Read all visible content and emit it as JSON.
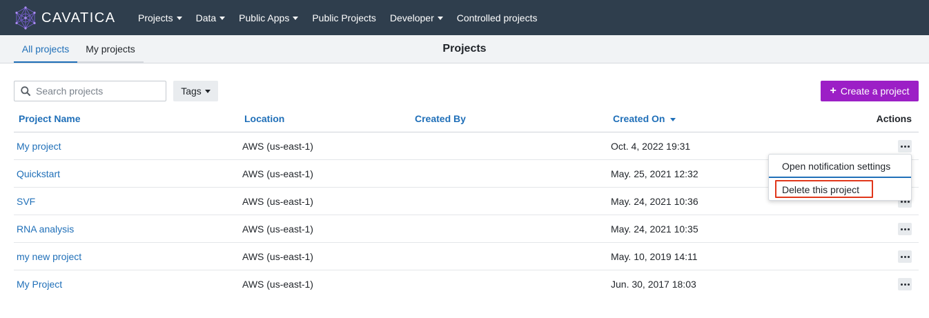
{
  "app": {
    "logo_text": "CAVATICA"
  },
  "nav": {
    "items": [
      {
        "label": "Projects",
        "dropdown": true
      },
      {
        "label": "Data",
        "dropdown": true
      },
      {
        "label": "Public Apps",
        "dropdown": true
      },
      {
        "label": "Public Projects",
        "dropdown": false
      },
      {
        "label": "Developer",
        "dropdown": true
      },
      {
        "label": "Controlled projects",
        "dropdown": false
      }
    ]
  },
  "subheader": {
    "tabs": [
      {
        "label": "All projects",
        "active": true
      },
      {
        "label": "My projects",
        "active": false
      }
    ],
    "title": "Projects"
  },
  "toolbar": {
    "search_placeholder": "Search projects",
    "search_value": "",
    "tags_label": "Tags",
    "create_label": "Create a project"
  },
  "table": {
    "columns": [
      "Project Name",
      "Location",
      "Created By",
      "Created On",
      "Actions"
    ],
    "sorted_column": "Created On",
    "sort_direction": "descending",
    "rows": [
      {
        "name": "My project",
        "location": "AWS (us-east-1)",
        "created_by": "",
        "created_on": "Oct. 4, 2022 19:31"
      },
      {
        "name": "Quickstart",
        "location": "AWS (us-east-1)",
        "created_by": "",
        "created_on": "May. 25, 2021 12:32"
      },
      {
        "name": "SVF",
        "location": "AWS (us-east-1)",
        "created_by": "",
        "created_on": "May. 24, 2021 10:36"
      },
      {
        "name": "RNA analysis",
        "location": "AWS (us-east-1)",
        "created_by": "",
        "created_on": "May. 24, 2021 10:35"
      },
      {
        "name": "my new project",
        "location": "AWS (us-east-1)",
        "created_by": "",
        "created_on": "May. 10, 2019 14:11"
      },
      {
        "name": "My Project",
        "location": "AWS (us-east-1)",
        "created_by": "",
        "created_on": "Jun. 30, 2017 18:03"
      }
    ]
  },
  "actions_menu": {
    "open_for_row": 0,
    "items": [
      "Open notification settings",
      "Delete this project"
    ],
    "highlighted_item": "Delete this project"
  },
  "colors": {
    "topbar_bg": "#2f3e4d",
    "link_blue": "#1f6fb8",
    "create_button": "#9c1fc6",
    "highlight_border": "#e0361a"
  },
  "icons": {
    "logo": "cavatica-network-logo",
    "search": "search-icon",
    "more": "more-horizontal-icon",
    "plus": "plus-icon",
    "caret": "caret-down-icon"
  }
}
